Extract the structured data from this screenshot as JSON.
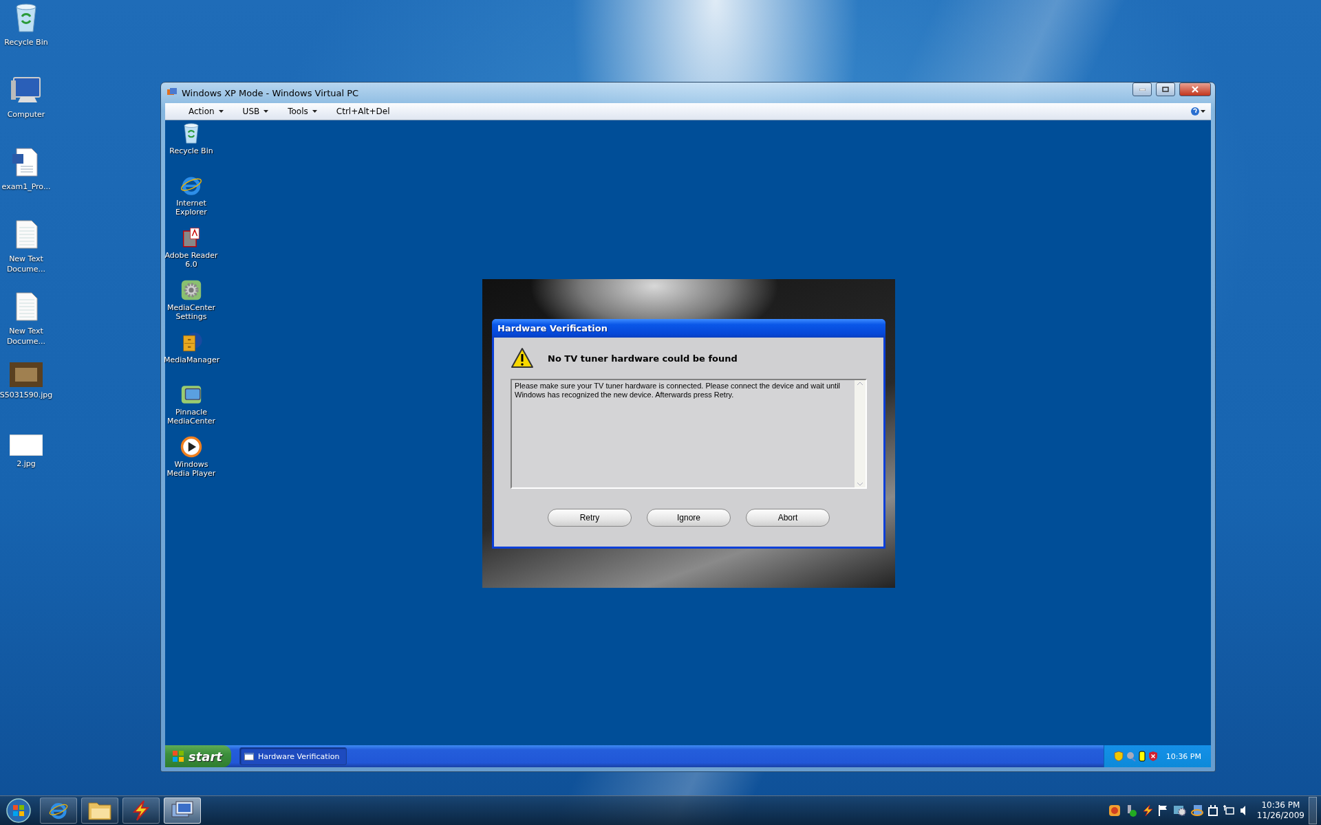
{
  "desktop_icons": [
    {
      "label": "Recycle Bin",
      "kind": "recycle"
    },
    {
      "label": "Computer",
      "kind": "computer"
    },
    {
      "label": "exam1_Pro...",
      "kind": "word"
    },
    {
      "label": "New Text Docume...",
      "kind": "text"
    },
    {
      "label": "New Text Docume...",
      "kind": "text"
    },
    {
      "label": "S5031590.jpg",
      "kind": "photo"
    },
    {
      "label": "2.jpg",
      "kind": "blank"
    }
  ],
  "vm_window": {
    "title": "Windows XP Mode - Windows Virtual PC",
    "menu": [
      {
        "label": "Action",
        "dropdown": true
      },
      {
        "label": "USB",
        "dropdown": true
      },
      {
        "label": "Tools",
        "dropdown": true
      },
      {
        "label": "Ctrl+Alt+Del",
        "dropdown": false
      }
    ],
    "guest_icons": [
      {
        "label": "Recycle Bin",
        "kind": "recycle"
      },
      {
        "label": "Internet Explorer",
        "kind": "browser"
      },
      {
        "label": "Adobe Reader 6.0",
        "kind": "reader"
      },
      {
        "label": "MediaCenter Settings",
        "kind": "gear"
      },
      {
        "label": "MediaManager",
        "kind": "cabinet"
      },
      {
        "label": "Pinnacle MediaCenter",
        "kind": "monitor"
      },
      {
        "label": "Windows Media Player",
        "kind": "player"
      }
    ],
    "dialog": {
      "title": "Hardware Verification",
      "heading": "No TV tuner hardware could be found",
      "message": "Please make sure your TV tuner hardware is connected. Please connect the device and wait until Windows has recognized the new device. Afterwards press Retry.",
      "buttons": [
        "Retry",
        "Ignore",
        "Abort"
      ]
    },
    "guest_taskbar": {
      "start": "start",
      "tasks": [
        {
          "label": "Hardware Verification",
          "selected": true
        }
      ],
      "clock": "10:36 PM"
    }
  },
  "taskbar": {
    "pinned": [
      {
        "kind": "browser",
        "selected": false
      },
      {
        "kind": "folder",
        "selected": false
      },
      {
        "kind": "flash",
        "selected": false
      },
      {
        "kind": "vpc",
        "selected": true
      }
    ],
    "time": "10:36 PM",
    "date": "11/26/2009"
  }
}
